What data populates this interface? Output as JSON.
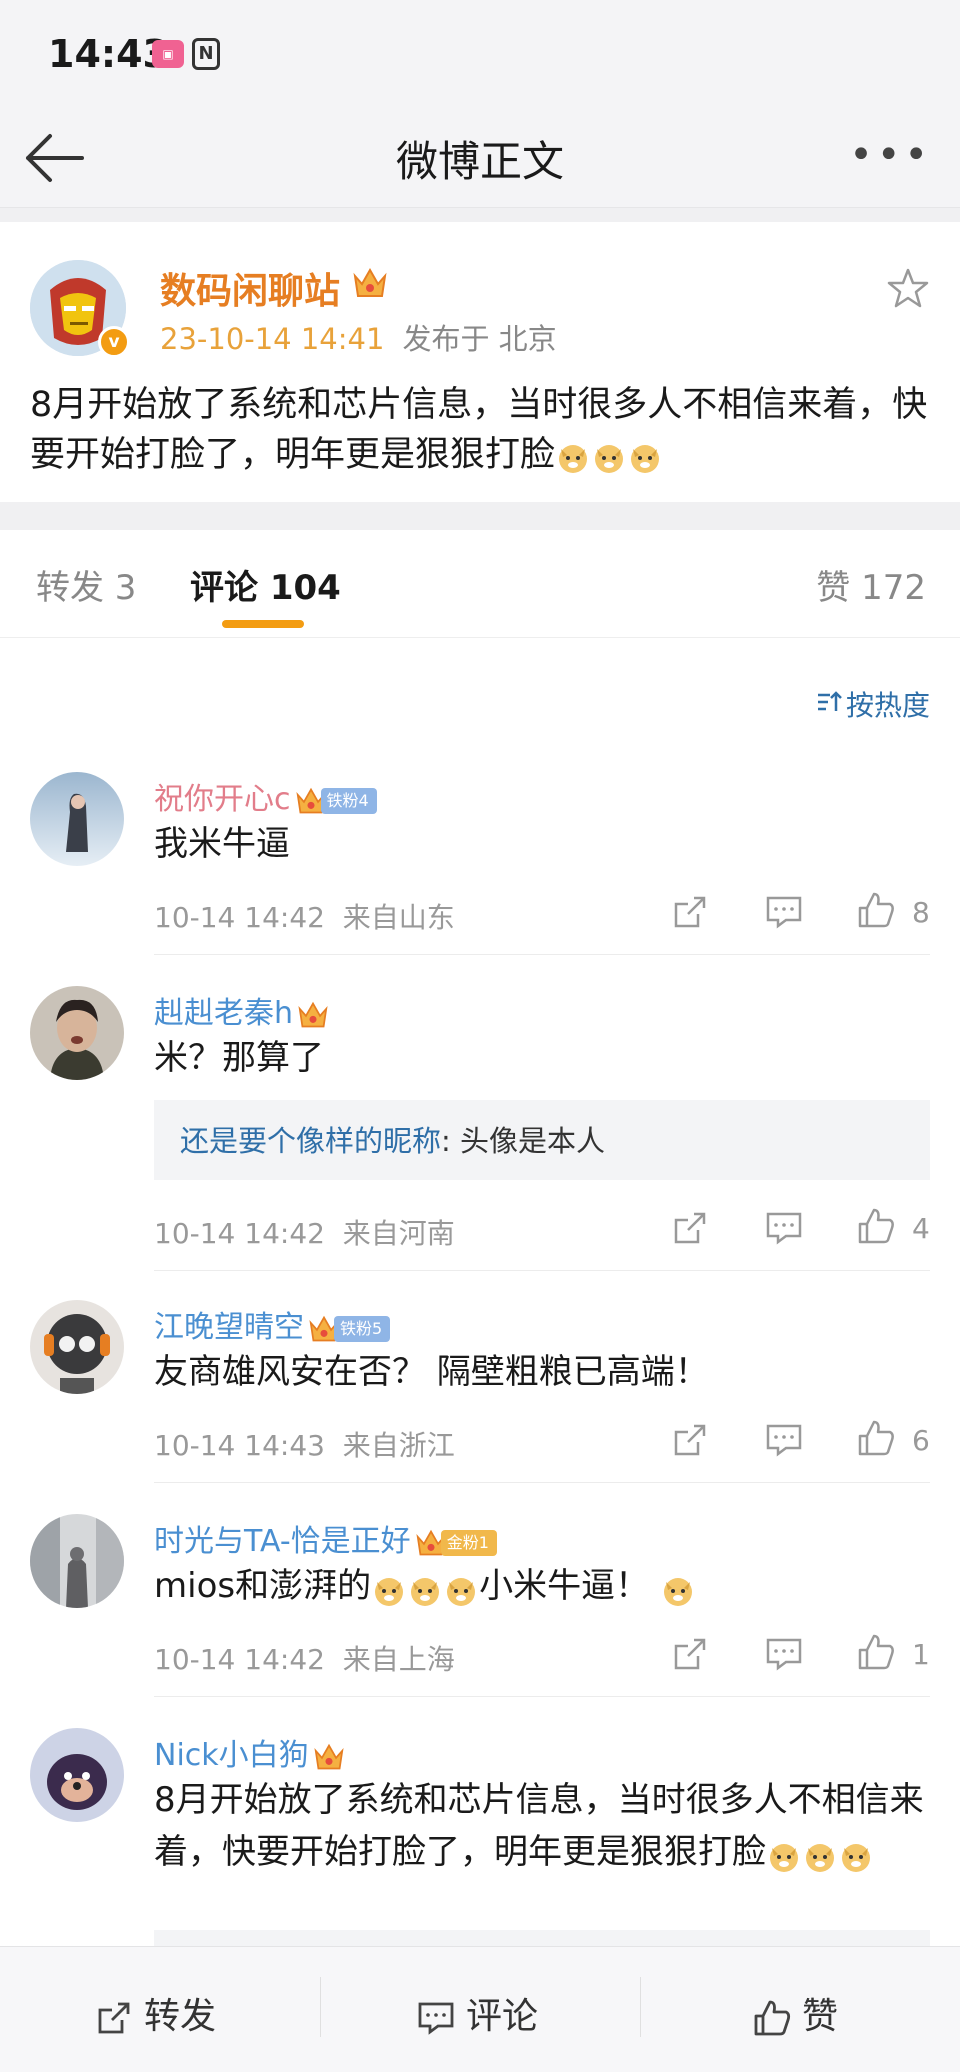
{
  "status_bar": {
    "time": "14:43",
    "app_badge": "bilibili",
    "nfc": "N"
  },
  "header": {
    "title": "微博正文"
  },
  "post": {
    "author": "数码闲聊站",
    "date": "23-10-14 14:41",
    "location": "发布于 北京",
    "verified_mark": "v",
    "text": "8月开始放了系统和芯片信息，当时很多人不相信来着，快要开始打脸了，明年更是狠狠打脸"
  },
  "tabs": {
    "repost": "转发 3",
    "comment": "评论 104",
    "like": "赞 172"
  },
  "sort": {
    "label": "按热度",
    "icon": "sort-icon"
  },
  "comments": [
    {
      "name": "祝你开心c",
      "fan": "铁粉4",
      "text": "我米牛逼",
      "time": "10-14 14:42",
      "loc": "来自山东",
      "likes": "8"
    },
    {
      "name": "赳赳老秦h",
      "text": "米？那算了",
      "reply_name": "还是要个像样的昵称",
      "reply_text": ": 头像是本人",
      "time": "10-14 14:42",
      "loc": "来自河南",
      "likes": "4"
    },
    {
      "name": "江晚望晴空",
      "fan": "铁粉5",
      "text": "友商雄风安在否？ 隔壁粗粮已高端！",
      "time": "10-14 14:43",
      "loc": "来自浙江",
      "likes": "6"
    },
    {
      "name": "时光与TA-恰是正好",
      "fan": "金粉1",
      "text_a": "mios和澎湃的",
      "text_b": "小米牛逼！",
      "time": "10-14 14:42",
      "loc": "来自上海",
      "likes": "1"
    },
    {
      "name": "Nick小白狗",
      "text": "8月开始放了系统和芯片信息，当时很多人不相信来着，快要开始打脸了，明年更是狠狠打脸"
    }
  ],
  "bottom_bar": {
    "repost": "转发",
    "comment": "评论",
    "like": "赞"
  },
  "colors": {
    "accent": "#f39c12",
    "link": "#2f6fa8",
    "author": "#e67e22"
  }
}
